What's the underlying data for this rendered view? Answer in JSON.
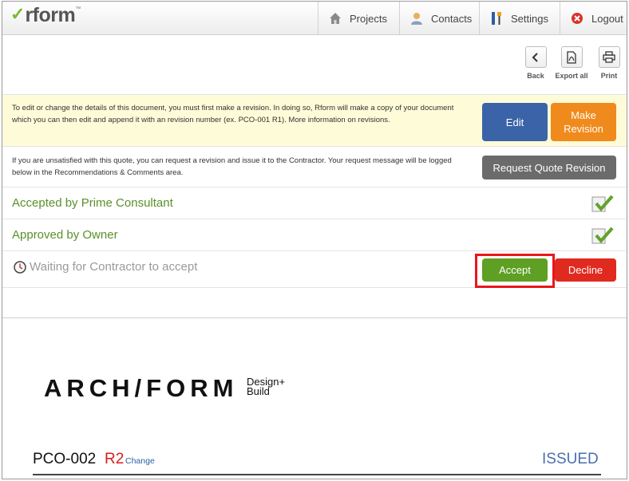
{
  "logo": {
    "check": "✓",
    "text": "rform",
    "tm": "™"
  },
  "nav": [
    {
      "label": "Projects",
      "icon": "house-icon"
    },
    {
      "label": "Contacts",
      "icon": "person-icon"
    },
    {
      "label": "Settings",
      "icon": "tools-icon"
    },
    {
      "label": "Logout",
      "icon": "logout-x-icon"
    }
  ],
  "toolbar": {
    "back": "Back",
    "export_all": "Export all",
    "print": "Print"
  },
  "revision_notice": {
    "text": "To edit or change the details of this document, you must first make a revision. In doing so, Rform will make a copy of your document which you can then edit and append it with an revision number (ex. PCO-001 R1). More information on revisions.",
    "edit_label": "Edit",
    "make_revision_label": "Make Revision"
  },
  "quote_notice": {
    "text": "If you are unsatisfied with this quote, you can request a revision and issue it to the Contractor. Your request message will be logged below in the Recommendations & Comments area.",
    "request_label": "Request Quote Revision"
  },
  "statuses": {
    "prime": "Accepted by Prime Consultant",
    "owner": "Approved by Owner",
    "contractor": "Waiting for Contractor to accept"
  },
  "actions": {
    "accept": "Accept",
    "decline": "Decline"
  },
  "document": {
    "brand_main": "ARCH/FORM",
    "brand_sub1": "Design+",
    "brand_sub2": "Build",
    "number": "PCO-002",
    "revision": "R2",
    "change_link": "Change",
    "status": "ISSUED"
  },
  "colors": {
    "edit_blue": "#3a63a8",
    "make_revision_orange": "#f08a1c",
    "request_gray": "#6b6b6b",
    "accept_green": "#5f9f24",
    "decline_red": "#e02a20",
    "highlight_red": "#e8171c",
    "status_green": "#5b8f2a",
    "issued_blue": "#4a6fb0"
  }
}
